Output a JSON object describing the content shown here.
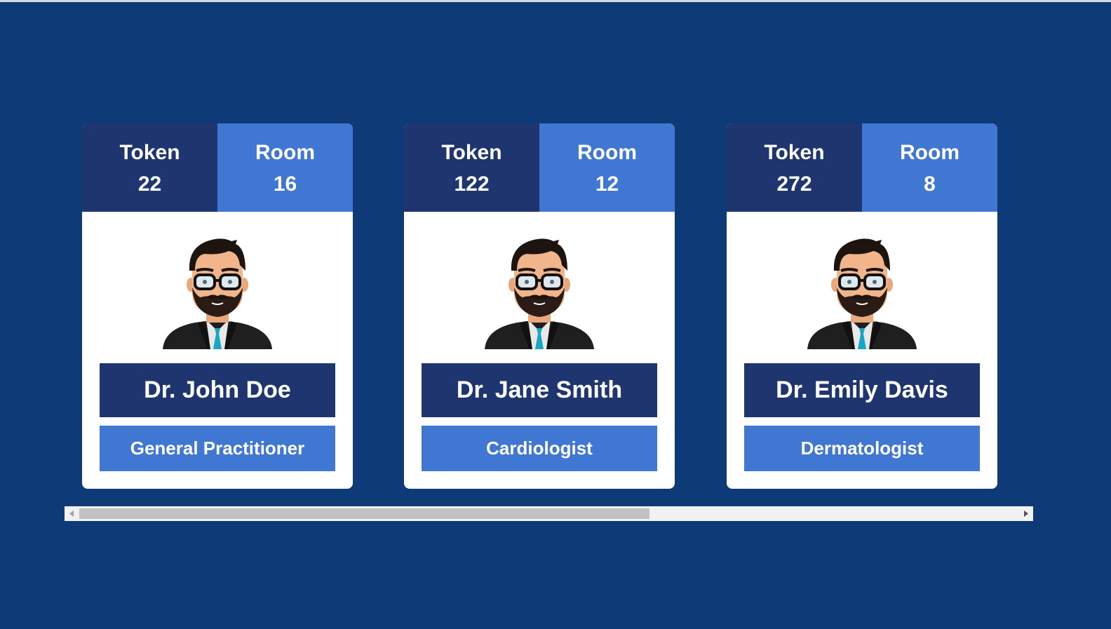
{
  "cards": [
    {
      "token_label": "Token",
      "token_value": "22",
      "room_label": "Room",
      "room_value": "16",
      "name": "Dr. John Doe",
      "specialty": "General Practitioner"
    },
    {
      "token_label": "Token",
      "token_value": "122",
      "room_label": "Room",
      "room_value": "12",
      "name": "Dr. Jane Smith",
      "specialty": "Cardiologist"
    },
    {
      "token_label": "Token",
      "token_value": "272",
      "room_label": "Room",
      "room_value": "8",
      "name": "Dr. Emily Davis",
      "specialty": "Dermatologist"
    }
  ],
  "icons": {
    "avatar": "doctor-avatar-icon",
    "scroll_left": "scroll-left-arrow-icon",
    "scroll_right": "scroll-right-arrow-icon"
  },
  "scroll": {
    "position_fraction": 0.0,
    "visible_fraction": 0.59
  },
  "colors": {
    "background": "#0e3b77",
    "dark_blue": "#1e3570",
    "light_blue": "#3f77d2",
    "card": "#ffffff"
  }
}
